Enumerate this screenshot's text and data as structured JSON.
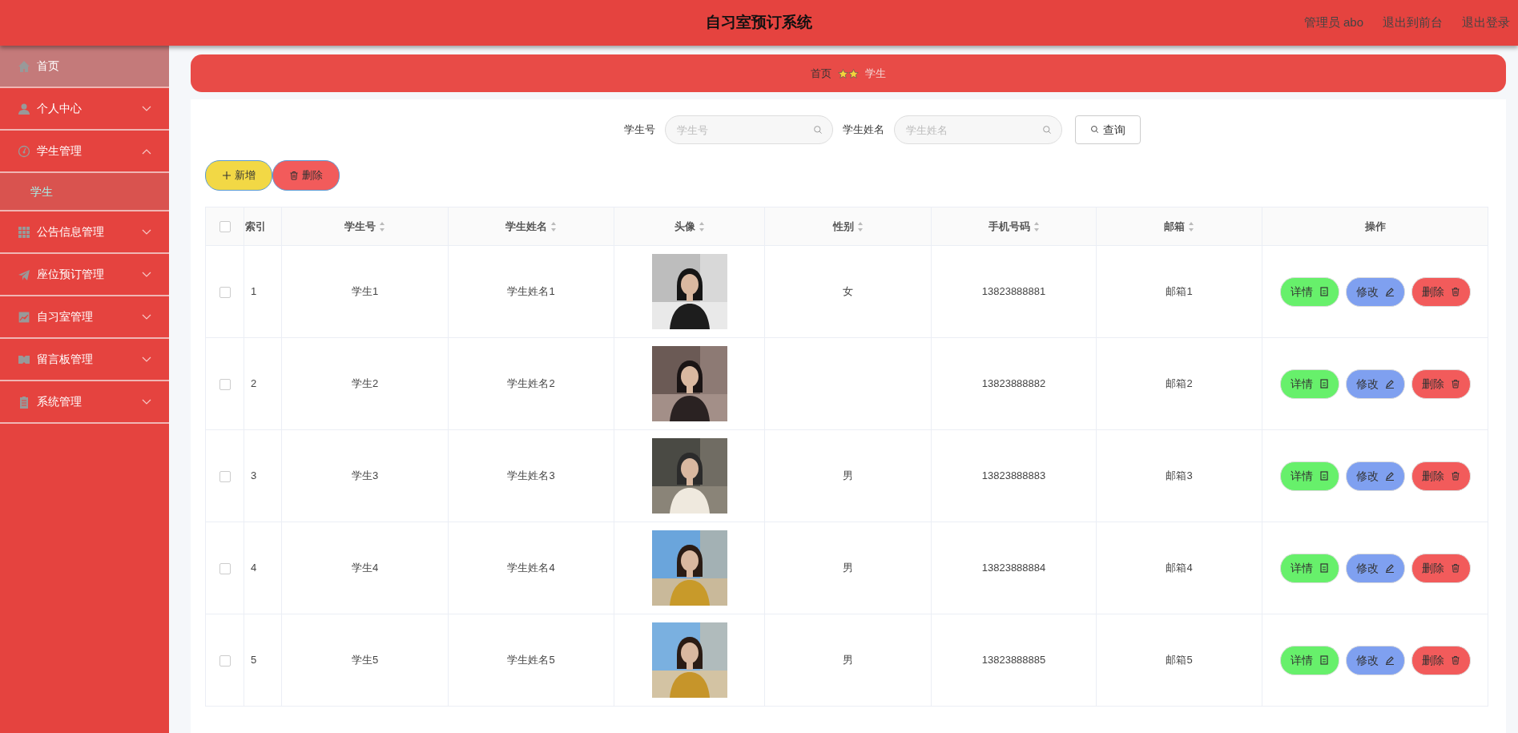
{
  "header": {
    "title": "自习室预订系统",
    "links": [
      "管理员 abo",
      "退出到前台",
      "退出登录"
    ]
  },
  "sidebar": {
    "items": [
      {
        "label": "首页",
        "selected": true
      },
      {
        "label": "个人中心",
        "selected": false,
        "expanded": false
      },
      {
        "label": "学生管理",
        "selected": false,
        "expanded": true,
        "children": [
          {
            "label": "学生",
            "selected": true
          }
        ]
      },
      {
        "label": "公告信息管理",
        "selected": false,
        "expanded": false
      },
      {
        "label": "座位预订管理",
        "selected": false,
        "expanded": false
      },
      {
        "label": "自习室管理",
        "selected": false,
        "expanded": false
      },
      {
        "label": "留言板管理",
        "selected": false,
        "expanded": false
      },
      {
        "label": "系统管理",
        "selected": false,
        "expanded": false
      }
    ]
  },
  "breadcrumb": [
    "首页",
    "学生"
  ],
  "search": {
    "fields": [
      {
        "label": "学生号",
        "placeholder": "学生号"
      },
      {
        "label": "学生姓名",
        "placeholder": "学生姓名"
      }
    ],
    "button": "查询"
  },
  "actions": [
    {
      "kind": "add",
      "label": "新增"
    },
    {
      "kind": "delete",
      "label": "删除"
    }
  ],
  "table": {
    "select_all_checked": false,
    "columns": [
      {
        "label": "索引",
        "sortable": false
      },
      {
        "label": "学生号",
        "sortable": true
      },
      {
        "label": "学生姓名",
        "sortable": true
      },
      {
        "label": "头像",
        "sortable": true
      },
      {
        "label": "性别",
        "sortable": true
      },
      {
        "label": "手机号码",
        "sortable": true
      },
      {
        "label": "邮箱",
        "sortable": true
      },
      {
        "label": "操作",
        "sortable": false
      }
    ],
    "rows": [
      {
        "checked": false,
        "index": "1",
        "student_no": "学生1",
        "name": "学生姓名1",
        "gender": "女",
        "phone": "13823888881",
        "email": "邮箱1",
        "actions": [
          {
            "kind": "detail",
            "label": "详情"
          },
          {
            "kind": "edit",
            "label": "修改"
          },
          {
            "kind": "delete",
            "label": "删除"
          }
        ]
      },
      {
        "checked": false,
        "index": "2",
        "student_no": "学生2",
        "name": "学生姓名2",
        "phone": "13823888882",
        "email": "邮箱2",
        "actions": [
          {
            "kind": "detail",
            "label": "详情"
          },
          {
            "kind": "edit",
            "label": "修改"
          },
          {
            "kind": "delete",
            "label": "删除"
          }
        ]
      },
      {
        "checked": false,
        "index": "3",
        "student_no": "学生3",
        "name": "学生姓名3",
        "gender": "男",
        "phone": "13823888883",
        "email": "邮箱3",
        "actions": [
          {
            "kind": "detail",
            "label": "详情"
          },
          {
            "kind": "edit",
            "label": "修改"
          },
          {
            "kind": "delete",
            "label": "删除"
          }
        ]
      },
      {
        "checked": false,
        "index": "4",
        "student_no": "学生4",
        "name": "学生姓名4",
        "gender": "男",
        "phone": "13823888884",
        "email": "邮箱4",
        "actions": [
          {
            "kind": "detail",
            "label": "详情"
          },
          {
            "kind": "edit",
            "label": "修改"
          },
          {
            "kind": "delete",
            "label": "删除"
          }
        ]
      },
      {
        "checked": false,
        "index": "5",
        "student_no": "学生5",
        "name": "学生姓名5",
        "gender": "男",
        "phone": "13823888885",
        "email": "邮箱5",
        "actions": [
          {
            "kind": "detail",
            "label": "详情"
          },
          {
            "kind": "edit",
            "label": "修改"
          },
          {
            "kind": "delete",
            "label": "删除"
          }
        ]
      }
    ]
  }
}
